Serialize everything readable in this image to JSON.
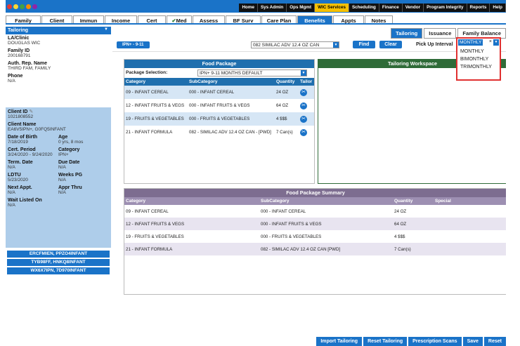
{
  "topmenu": [
    "Home",
    "Sys Admin",
    "Ops Mgmt",
    "WIC Services",
    "Scheduling",
    "Finance",
    "Vendor",
    "Program Integrity",
    "Reports",
    "Help"
  ],
  "tabs": [
    "Family",
    "Client",
    "Immun",
    "Income",
    "Cert",
    "Med",
    "Assess",
    "BF Surv",
    "Care Plan",
    "Benefits",
    "Appts",
    "Notes"
  ],
  "side": {
    "title": "Tailoring",
    "clinic_label": "LA/Clinic",
    "clinic": "DOUGLAS WIC",
    "family_label": "Family ID",
    "family": "200168791",
    "auth_label": "Auth. Rep. Name",
    "auth": "THIRD FAM, FAMILY",
    "phone_label": "Phone",
    "phone": "N/A",
    "client_label": "Client ID",
    "client": "1021808552",
    "cname_label": "Client Name",
    "cname": "EA6V5IPN+, G0FQ5INFANT",
    "dob_label": "Date of Birth",
    "dob": "7/18/2019",
    "age_label": "Age",
    "age": "0 yrs, 8 mos",
    "cert_label": "Cert. Period",
    "cert": "3/24/2020 - 9/24/2020",
    "cat_label": "Category",
    "cat": "IPN+",
    "term_label": "Term. Date",
    "term": "N/A",
    "due_label": "Due Date",
    "due": "N/A",
    "ldtu_label": "LDTU",
    "ldtu": "5/23/2020",
    "weeks_label": "Weeks PG",
    "weeks": "N/A",
    "next_label": "Next Appt.",
    "next": "N/A",
    "thru_label": "Appr Thru",
    "thru": "N/A",
    "wait_label": "Wait Listed On",
    "wait": "N/A",
    "links": [
      "ERCFMIEN, PPZO4INFANT",
      "TYB98FF, HNKQ8INFANT",
      "WX6X7IPN, 7D970INFANT"
    ]
  },
  "subtabs": [
    "Tailoring",
    "Issuance",
    "Family Balance"
  ],
  "toolbar": {
    "pill": "IPN+ - 9-11",
    "select": "082 SIMILAC ADV 12.4 OZ CAN",
    "find": "Find",
    "clear": "Clear",
    "interval_label": "Pick Up Interval",
    "interval": "MONTHLY"
  },
  "dropdown": [
    "MONTHLY",
    "BIMONTHLY",
    "TRIMONTHLY"
  ],
  "foodpkg": {
    "title": "Food Package",
    "sel_label": "Package Selection:",
    "sel_value": "IPN+ 9-11 MONTHS DEFAULT",
    "headers": [
      "Category",
      "SubCategory",
      "Quantity",
      "Tailor"
    ],
    "rows": [
      [
        "09 - INFANT CEREAL",
        "000 - INFANT CEREAL",
        "24 OZ"
      ],
      [
        "12 - INFANT FRUITS & VEGS",
        "000 - INFANT FRUITS & VEGS",
        "64 OZ"
      ],
      [
        "19 - FRUITS & VEGETABLES",
        "000 - FRUITS & VEGETABLES",
        "4 $$$"
      ],
      [
        "21 - INFANT FORMULA",
        "082 - SIMILAC ADV 12.4 OZ CAN - [PWD]",
        "7 Can(s)"
      ]
    ]
  },
  "workspace": {
    "title": "Tailoring Workspace"
  },
  "summary": {
    "title": "Food Package Summary",
    "headers": [
      "Category",
      "SubCategory",
      "Quantity",
      "Special"
    ],
    "rows": [
      [
        "09 - INFANT CEREAL",
        "000 - INFANT CEREAL",
        "24 OZ"
      ],
      [
        "12 - INFANT FRUITS & VEGS",
        "000 - INFANT FRUITS & VEGS",
        "64 OZ"
      ],
      [
        "19 - FRUITS & VEGETABLES",
        "000 - FRUITS & VEGETABLES",
        "4 $$$"
      ],
      [
        "21 - INFANT FORMULA",
        "082 - SIMILAC ADV 12.4 OZ CAN [PWD]",
        "7 Can(s)"
      ]
    ]
  },
  "bottom": [
    "Import Tailoring",
    "Reset Tailoring",
    "Prescription Scans",
    "Save",
    "Reset"
  ],
  "colors": {
    "accent": "#1a73c8",
    "active_menu": "#f6c000",
    "food_header": "#1f6fae",
    "workspace_header": "#2f6b38",
    "summary_header": "#7d6d90",
    "highlight": "#e03030"
  }
}
